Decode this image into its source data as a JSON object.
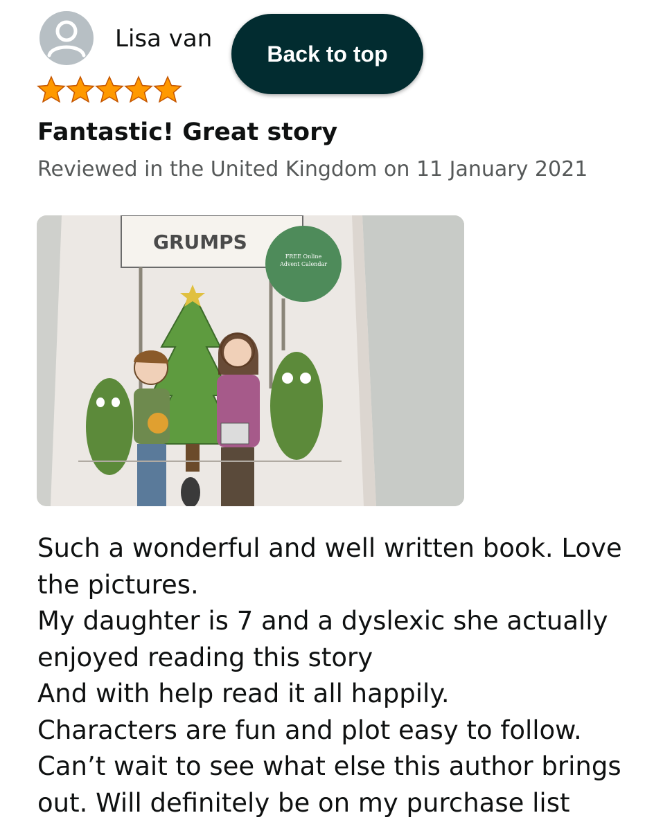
{
  "reviewer": {
    "name": "Lisa van",
    "avatar_icon": "user-silhouette-icon"
  },
  "back_to_top": {
    "label": "Back to top"
  },
  "rating": {
    "stars": 5,
    "out_of": 5,
    "star_color": "#ff9900",
    "star_icon": "star-icon"
  },
  "review": {
    "title": "Fantastic! Great story",
    "meta": "Reviewed in the United Kingdom on 11 January 2021",
    "photo": {
      "sign_text": "GRUMPS",
      "badge_text_1": "FREE Online",
      "badge_text_2": "Advent Calendar"
    },
    "body_lines": [
      "Such a wonderful and well written book. Love",
      "the pictures.",
      "My daughter is 7 and a dyslexic she actually",
      "enjoyed reading this story",
      "And with help read it all happily.",
      "Characters are fun and plot easy to follow.",
      "Can’t wait to see what else this author brings",
      "out. Will definitely be on my purchase list"
    ]
  },
  "colors": {
    "button_bg": "#022c30",
    "meta_text": "#565959",
    "body_text": "#0f1111"
  }
}
